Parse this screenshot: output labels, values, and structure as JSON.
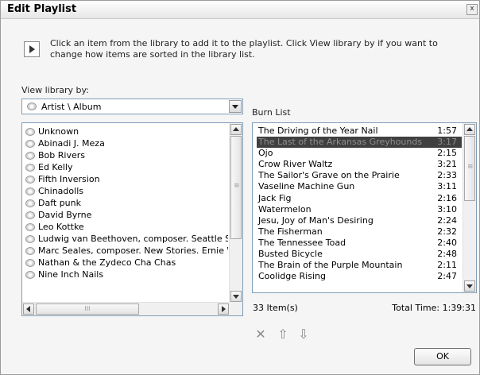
{
  "dialog": {
    "title": "Edit Playlist",
    "close_label": "x"
  },
  "info": {
    "text": "Click an item from the library to add it to the playlist. Click View library by if you want to change how items are sorted in the library list."
  },
  "library": {
    "view_label": "View library by:",
    "view_value": "Artist \\ Album",
    "items": [
      "Unknown",
      "Abinadi J. Meza",
      "Bob Rivers",
      "Ed Kelly",
      "Fifth Inversion",
      "Chinadolls",
      "Daft punk",
      "David Byrne",
      "Leo Kottke",
      "Ludwig van Beethoven, composer. Seattle Sy",
      "Marc Seales, composer. New Stories. Ernie W",
      "Nathan & the Zydeco Cha Chas",
      "Nine Inch Nails"
    ],
    "hscroll_thumb_label": "III"
  },
  "burn": {
    "label": "Burn List",
    "tracks": [
      {
        "title": "The Driving of the Year Nail",
        "time": "1:57"
      },
      {
        "title": "The Last of the Arkansas Greyhounds",
        "time": "3:17",
        "selected": true
      },
      {
        "title": "Ojo",
        "time": "2:15"
      },
      {
        "title": "Crow River Waltz",
        "time": "3:21"
      },
      {
        "title": "The Sailor's Grave on the Prairie",
        "time": "2:33"
      },
      {
        "title": "Vaseline Machine Gun",
        "time": "3:11"
      },
      {
        "title": "Jack Fig",
        "time": "2:16"
      },
      {
        "title": "Watermelon",
        "time": "3:10"
      },
      {
        "title": "Jesu, Joy of Man's Desiring",
        "time": "2:24"
      },
      {
        "title": "The Fisherman",
        "time": "2:32"
      },
      {
        "title": "The Tennessee Toad",
        "time": "2:40"
      },
      {
        "title": "Busted Bicycle",
        "time": "2:48"
      },
      {
        "title": "The Brain of the Purple Mountain",
        "time": "2:11"
      },
      {
        "title": "Coolidge Rising",
        "time": "2:47"
      }
    ],
    "item_count": "33 Item(s)",
    "total_time": "Total Time: 1:39:31"
  },
  "actions": {
    "remove_icon": "x-icon",
    "move_up_icon": "arrow-up-icon",
    "move_down_icon": "arrow-down-icon"
  },
  "buttons": {
    "ok_label": "OK"
  },
  "colors": {
    "selected_row_bg": "#404040",
    "selected_row_text": "#8f8f8f",
    "listbox_border": "#7f9db9"
  }
}
